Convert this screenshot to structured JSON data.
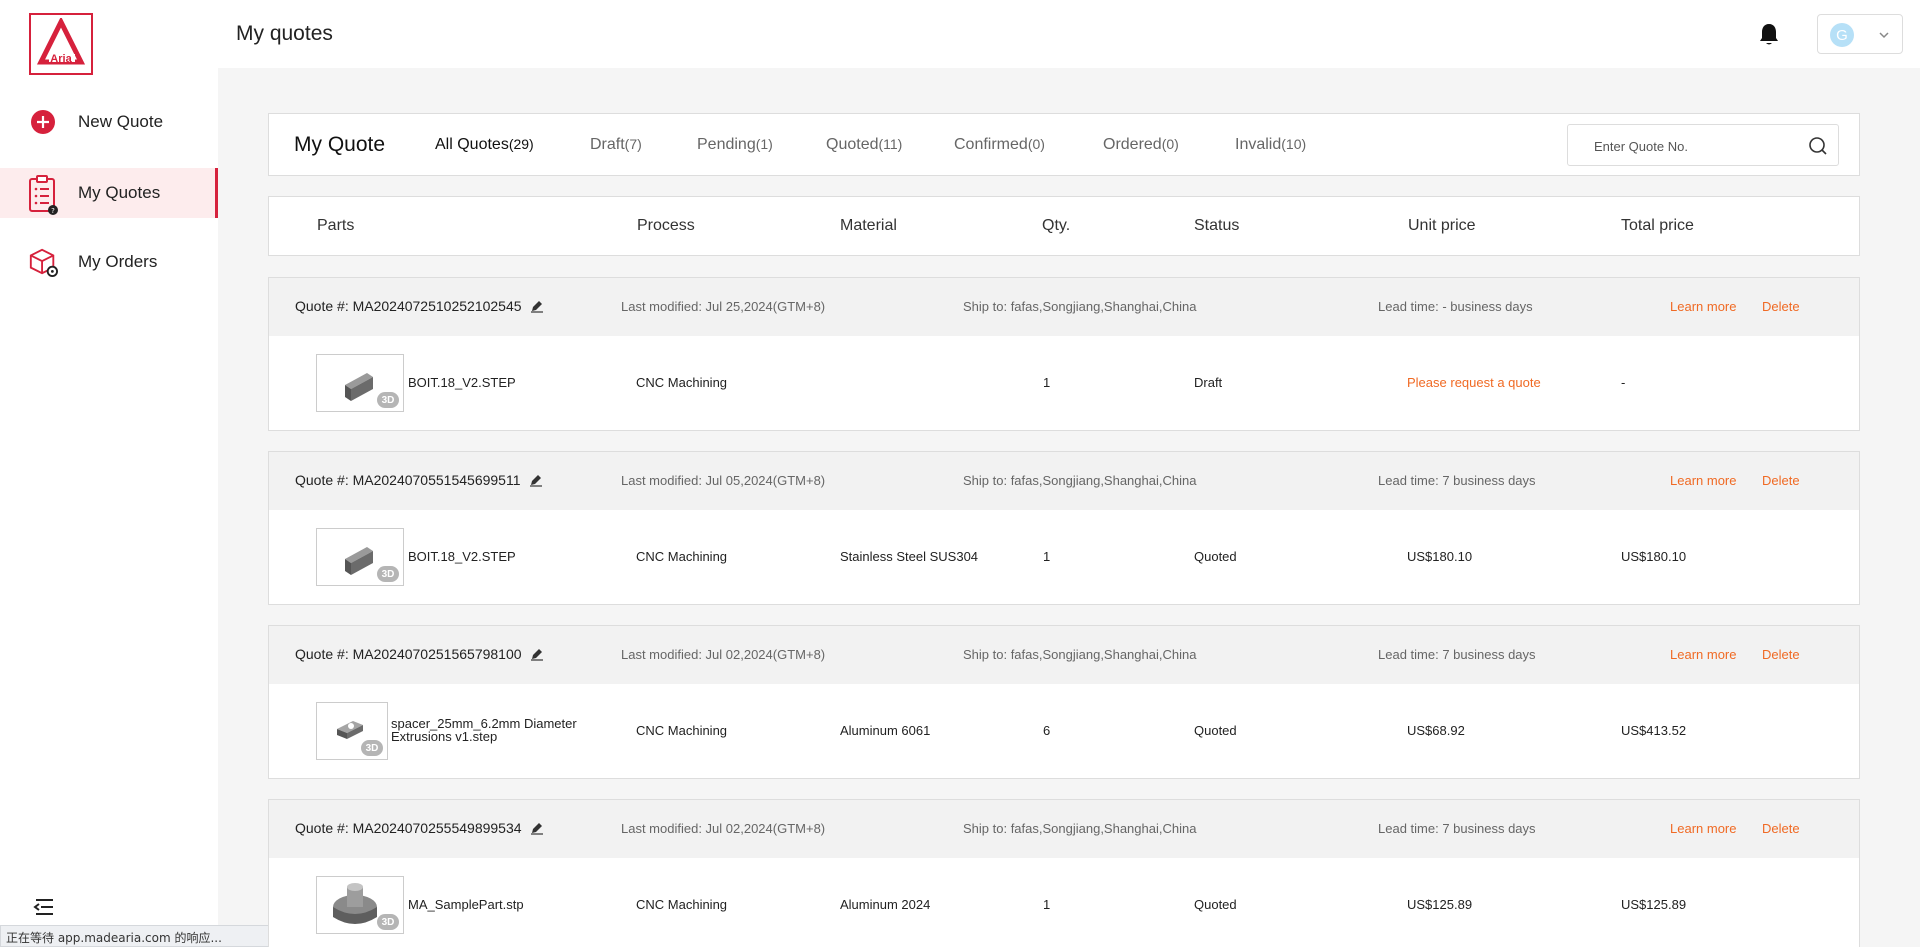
{
  "app": {
    "logo_text": "Aria",
    "brand_color": "#d6213c",
    "accent_color": "#f06a24"
  },
  "sidebar": {
    "items": [
      {
        "label": "New Quote",
        "icon": "plus-circle-icon"
      },
      {
        "label": "My Quotes",
        "icon": "clipboard-list-icon",
        "active": true
      },
      {
        "label": "My Orders",
        "icon": "box-gear-icon"
      }
    ]
  },
  "header": {
    "title": "My quotes",
    "avatar_letter": "G"
  },
  "filter": {
    "title": "My Quote",
    "tabs": [
      {
        "label": "All Quotes",
        "count": "(29)",
        "active": true
      },
      {
        "label": "Draft",
        "count": "(7)"
      },
      {
        "label": "Pending",
        "count": "(1)"
      },
      {
        "label": "Quoted",
        "count": "(11)"
      },
      {
        "label": "Confirmed",
        "count": "(0)"
      },
      {
        "label": "Ordered",
        "count": "(0)"
      },
      {
        "label": "Invalid",
        "count": "(10)"
      }
    ],
    "search_placeholder": "Enter Quote No."
  },
  "columns": [
    "Parts",
    "Process",
    "Material",
    "Qty.",
    "Status",
    "Unit price",
    "Total price"
  ],
  "actions": {
    "learn_more": "Learn more",
    "delete": "Delete"
  },
  "quotes": [
    {
      "number": "Quote #: MA2024072510252102545",
      "modified": "Last modified: Jul 25,2024(GTM+8)",
      "ship_to": "Ship to: fafas,Songjiang,Shanghai,China",
      "lead_time": "Lead time: - business days",
      "part": {
        "name": "BOIT.18_V2.STEP",
        "name2": "",
        "process": "CNC Machining",
        "material": "",
        "qty": "1",
        "status": "Draft",
        "unit_price": "Please request a quote",
        "total_price": "-"
      }
    },
    {
      "number": "Quote #: MA2024070551545699511",
      "modified": "Last modified: Jul 05,2024(GTM+8)",
      "ship_to": "Ship to: fafas,Songjiang,Shanghai,China",
      "lead_time": "Lead time: 7 business days",
      "part": {
        "name": "BOIT.18_V2.STEP",
        "name2": "",
        "process": "CNC Machining",
        "material": "Stainless Steel SUS304",
        "qty": "1",
        "status": "Quoted",
        "unit_price": "US$180.10",
        "total_price": "US$180.10"
      }
    },
    {
      "number": "Quote #: MA2024070251565798100",
      "modified": "Last modified: Jul 02,2024(GTM+8)",
      "ship_to": "Ship to: fafas,Songjiang,Shanghai,China",
      "lead_time": "Lead time: 7 business days",
      "part": {
        "name": "spacer_25mm_6.2mm Diameter",
        "name2": "Extrusions v1.step",
        "process": "CNC Machining",
        "material": "Aluminum 6061",
        "qty": "6",
        "status": "Quoted",
        "unit_price": "US$68.92",
        "total_price": "US$413.52"
      }
    },
    {
      "number": "Quote #: MA2024070255549899534",
      "modified": "Last modified: Jul 02,2024(GTM+8)",
      "ship_to": "Ship to: fafas,Songjiang,Shanghai,China",
      "lead_time": "Lead time: 7 business days",
      "part": {
        "name": "MA_SamplePart.stp",
        "name2": "",
        "process": "CNC Machining",
        "material": "Aluminum 2024",
        "qty": "1",
        "status": "Quoted",
        "unit_price": "US$125.89",
        "total_price": "US$125.89"
      }
    }
  ],
  "badge_3d": "3D",
  "browser_status": "正在等待 app.madearia.com 的响应..."
}
